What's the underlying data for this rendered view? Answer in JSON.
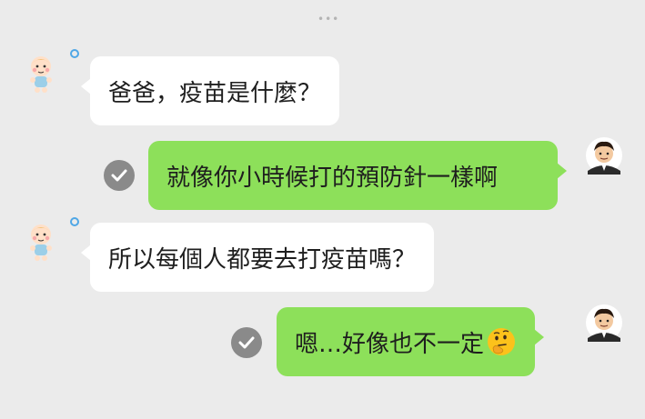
{
  "header": {
    "more_icon": "more-dots-icon"
  },
  "messages": [
    {
      "side": "left",
      "sender": "baby",
      "text": "爸爸，疫苗是什麼？"
    },
    {
      "side": "right",
      "sender": "dad",
      "text": "就像你小時候打的預防針一樣啊",
      "read": true
    },
    {
      "side": "left",
      "sender": "baby",
      "text": "所以每個人都要去打疫苗嗎？"
    },
    {
      "side": "right",
      "sender": "dad",
      "text": "嗯…好像也不一定",
      "emoji": "thinking-face",
      "read": true
    }
  ],
  "colors": {
    "background": "#ebebeb",
    "bubble_incoming": "#ffffff",
    "bubble_outgoing": "#8de05a",
    "status_ring": "#4fa7e6",
    "read_check": "#8a8a8a"
  }
}
